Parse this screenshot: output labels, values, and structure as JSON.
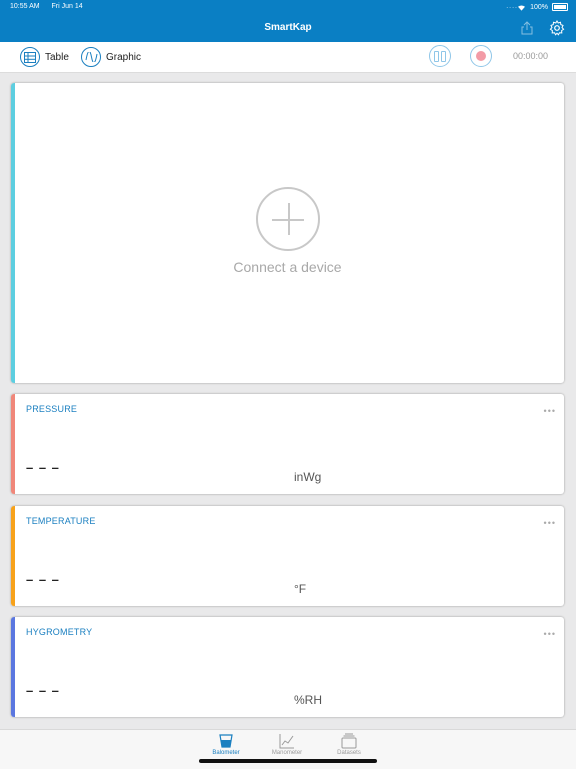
{
  "status_bar": {
    "time": "10:55 AM",
    "date": "Fri Jun 14",
    "battery": "100%",
    "signal_dots": "...."
  },
  "header": {
    "title": "SmartKap",
    "share_icon": "share-icon",
    "settings_icon": "gear-icon"
  },
  "toolbar": {
    "table_label": "Table",
    "graphic_label": "Graphic",
    "timer": "00:00:00",
    "accent": "#1a7fc0"
  },
  "main_card": {
    "connect_label": "Connect a device",
    "stripe_color": "#5dcee0"
  },
  "measurements": [
    {
      "title": "PRESSURE",
      "value": "– – –",
      "unit": "inWg",
      "stripe_color": "#f0877a",
      "more": "•••"
    },
    {
      "title": "TEMPERATURE",
      "value": "– – –",
      "unit": "°F",
      "stripe_color": "#f7a21b",
      "more": "•••"
    },
    {
      "title": "HYGROMETRY",
      "value": "– – –",
      "unit": "%RH",
      "stripe_color": "#5b77e0",
      "more": "•••"
    }
  ],
  "tabs": [
    {
      "label": "Balometer",
      "active": true
    },
    {
      "label": "Manometer",
      "active": false
    },
    {
      "label": "Datasets",
      "active": false
    }
  ],
  "colors": {
    "header_bg": "#0a7fc4",
    "page_bg": "#e9e9ea",
    "active_tab": "#1a7fc0"
  }
}
